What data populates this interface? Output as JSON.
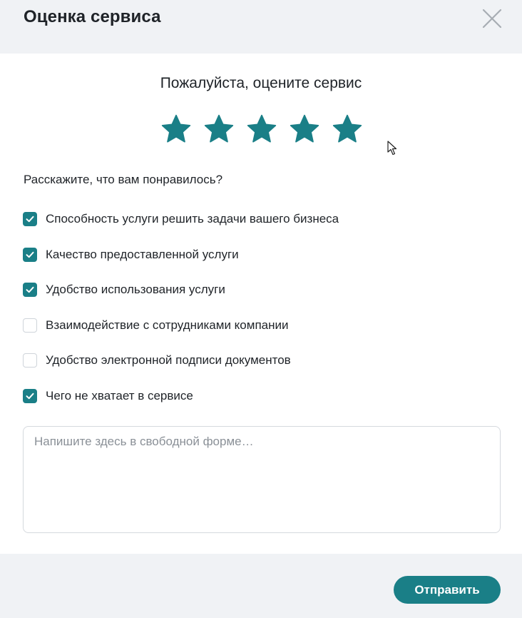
{
  "header": {
    "title": "Оценка сервиса"
  },
  "rating": {
    "prompt": "Пожалуйста, оцените сервис",
    "value": 5,
    "max": 5
  },
  "feedback": {
    "question": "Расскажите, что вам понравилось?",
    "options": [
      {
        "label": "Способность услуги решить задачи вашего бизнеса",
        "checked": true
      },
      {
        "label": "Качество предоставленной услуги",
        "checked": true
      },
      {
        "label": "Удобство использования услуги",
        "checked": true
      },
      {
        "label": "Взаимодействие с сотрудниками компании",
        "checked": false
      },
      {
        "label": "Удобство электронной подписи документов",
        "checked": false
      },
      {
        "label": "Чего не хватает в сервисе",
        "checked": true
      }
    ],
    "comment_placeholder": "Напишите здесь в свободной форме…",
    "comment_value": ""
  },
  "footer": {
    "submit_label": "Отправить"
  },
  "colors": {
    "accent": "#1a7f87",
    "header_bg": "#f0f2f5",
    "close_icon": "#a7adb3"
  }
}
